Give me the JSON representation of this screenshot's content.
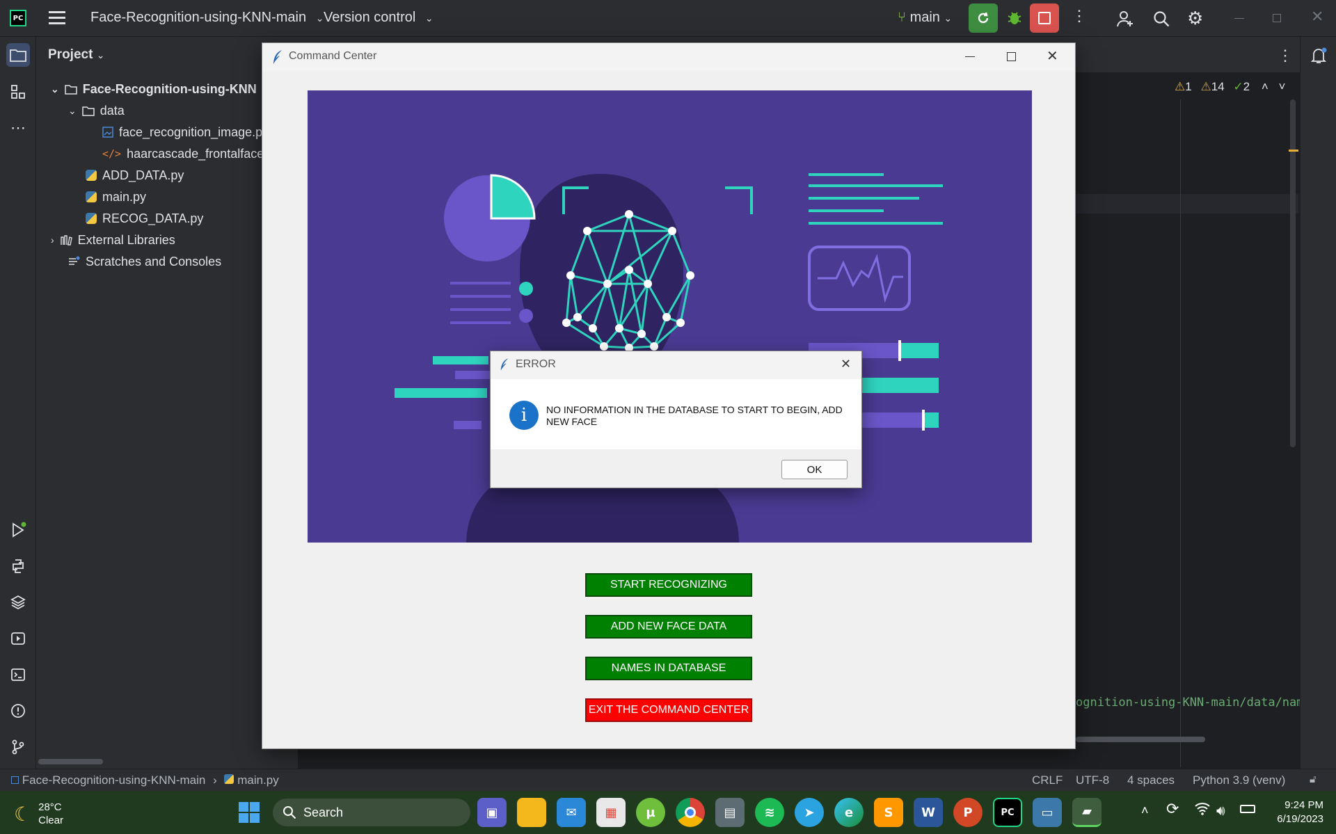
{
  "ide": {
    "project_name": "Face-Recognition-using-KNN-main",
    "version_control": "Version control",
    "branch": "main",
    "project_panel_title": "Project",
    "tree": [
      {
        "label": "Face-Recognition-using-KNN",
        "type": "folder-root"
      },
      {
        "label": "data",
        "type": "folder"
      },
      {
        "label": "face_recognition_image.p",
        "type": "image-file"
      },
      {
        "label": "haarcascade_frontalface_",
        "type": "xml-file"
      },
      {
        "label": "ADD_DATA.py",
        "type": "python-file"
      },
      {
        "label": "main.py",
        "type": "python-file"
      },
      {
        "label": "RECOG_DATA.py",
        "type": "python-file"
      },
      {
        "label": "External Libraries",
        "type": "libraries"
      },
      {
        "label": "Scratches and Consoles",
        "type": "scratches"
      }
    ],
    "inspections": {
      "warn1": "1",
      "warn2": "14",
      "ok": "2"
    },
    "editor_snippet": "ognition-using-KNN-main/data/nam",
    "status": {
      "breadcrumb_project": "Face-Recognition-using-KNN-main",
      "breadcrumb_file": "main.py",
      "line_sep": "CRLF",
      "encoding": "UTF-8",
      "indent": "4 spaces",
      "interpreter": "Python 3.9 (venv)"
    }
  },
  "command_center": {
    "title": "Command Center",
    "buttons": {
      "start": "START RECOGNIZING",
      "add": "ADD NEW FACE DATA",
      "names": "NAMES IN DATABASE",
      "exit": "EXIT THE COMMAND CENTER"
    }
  },
  "error_dialog": {
    "title": "ERROR",
    "message": "NO INFORMATION IN THE DATABASE TO START TO BEGIN, ADD NEW FACE",
    "ok_label": "OK"
  },
  "taskbar": {
    "temperature": "28°C",
    "weather": "Clear",
    "search_label": "Search",
    "time": "9:24 PM",
    "date": "6/19/2023"
  },
  "colors": {
    "accent_green": "#008000",
    "exit_red": "#ff0000",
    "banner_purple": "#4b3a92",
    "teal": "#2fd4bf"
  }
}
